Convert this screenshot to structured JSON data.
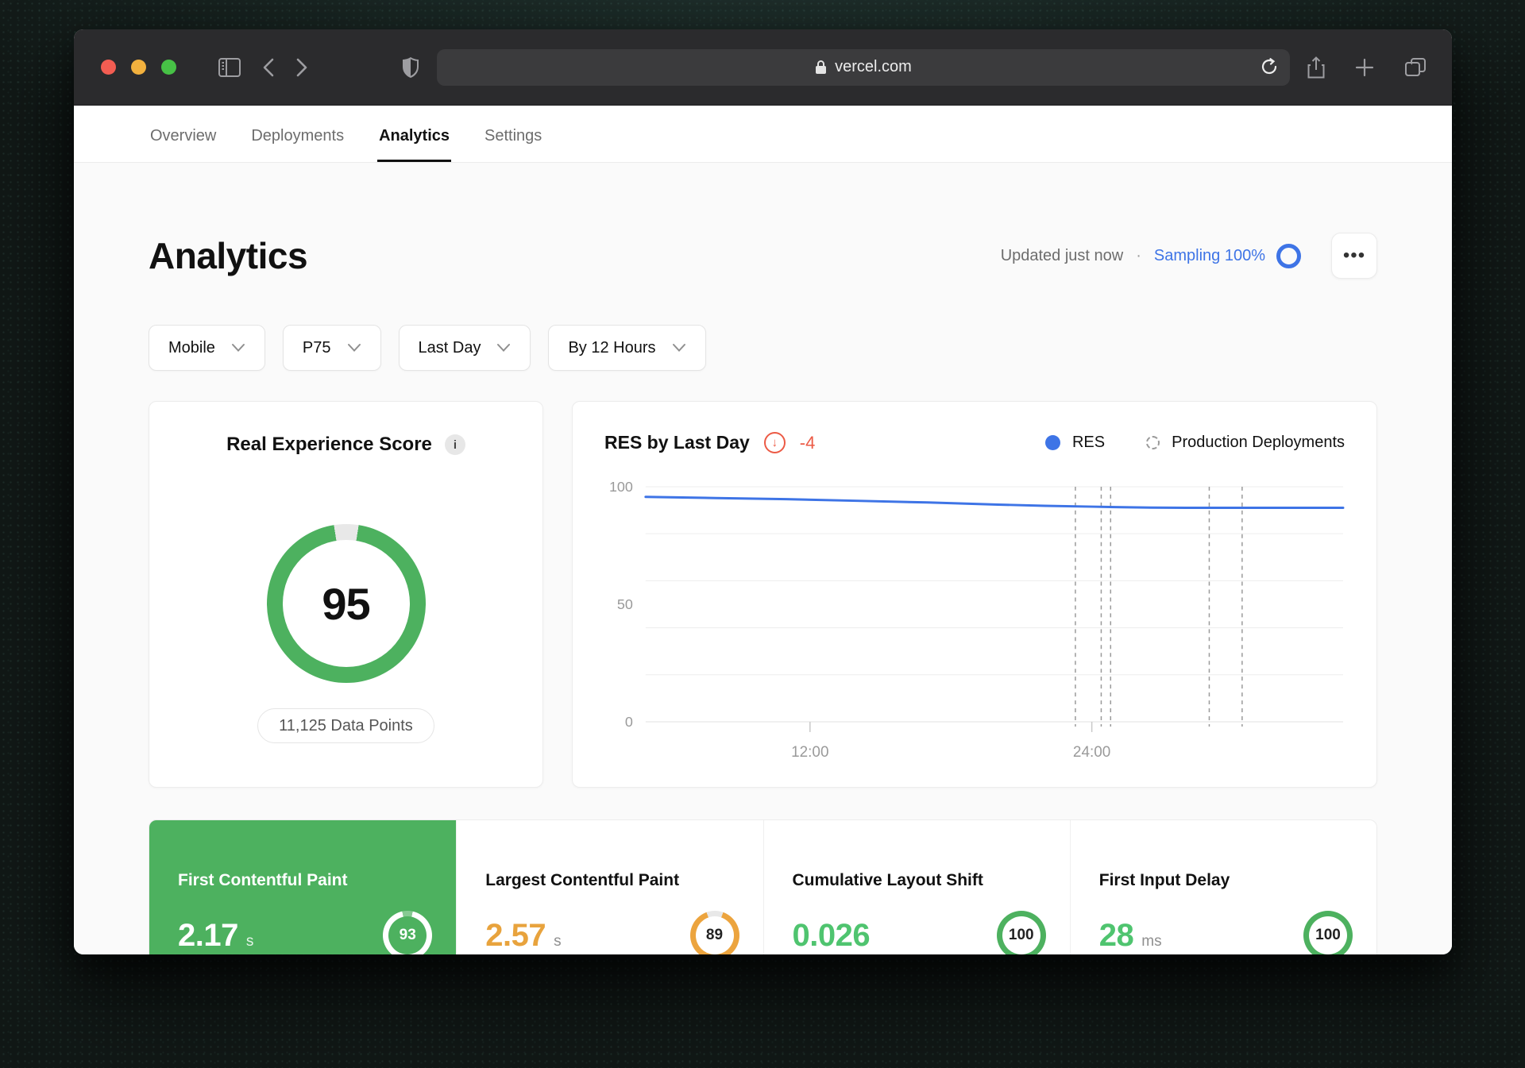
{
  "browser": {
    "url": "vercel.com",
    "window_controls": [
      "close",
      "minimize",
      "zoom"
    ]
  },
  "site_nav": {
    "tabs": [
      {
        "label": "Overview",
        "active": false
      },
      {
        "label": "Deployments",
        "active": false
      },
      {
        "label": "Analytics",
        "active": true
      },
      {
        "label": "Settings",
        "active": false
      }
    ]
  },
  "header": {
    "title": "Analytics",
    "updated": "Updated just now",
    "separator": "·",
    "sampling_label": "Sampling 100%",
    "more_label": "•••"
  },
  "filters": [
    {
      "label": "Mobile"
    },
    {
      "label": "P75"
    },
    {
      "label": "Last Day"
    },
    {
      "label": "By 12 Hours"
    }
  ],
  "res_card": {
    "title": "Real Experience Score",
    "score": "95",
    "score_value": 95,
    "pill": "11,125 Data Points"
  },
  "chart_card": {
    "title": "RES by Last Day",
    "delta_icon": "↓",
    "delta": "-4",
    "legend": [
      {
        "label": "RES"
      },
      {
        "label": "Production Deployments"
      }
    ]
  },
  "chart_data": {
    "type": "line",
    "title": "RES by Last Day",
    "x_unit": "hours",
    "x_domain": [
      5,
      34.7
    ],
    "x_ticks": [
      {
        "value": 12,
        "label": "12:00"
      },
      {
        "value": 24,
        "label": "24:00"
      }
    ],
    "y_domain": [
      0,
      100
    ],
    "y_gridlines": [
      0,
      20,
      40,
      60,
      80,
      100
    ],
    "y_tick_labels": [
      {
        "value": 100,
        "label": "100"
      },
      {
        "value": 50,
        "label": "50"
      },
      {
        "value": 0,
        "label": "0"
      }
    ],
    "grid": "horizontal",
    "legend_position": "top-right",
    "series": [
      {
        "name": "RES",
        "color_key": "blue",
        "points": [
          [
            5,
            95.7
          ],
          [
            8,
            95.2
          ],
          [
            11,
            94.7
          ],
          [
            14,
            94.0
          ],
          [
            17,
            93.3
          ],
          [
            20,
            92.4
          ],
          [
            22,
            91.9
          ],
          [
            24,
            91.5
          ],
          [
            25,
            91.3
          ],
          [
            26.5,
            91.1
          ],
          [
            28,
            91.0
          ],
          [
            31,
            91.0
          ],
          [
            34.7,
            91.0
          ]
        ]
      }
    ],
    "deployment_markers_x": [
      23.3,
      24.4,
      24.8,
      29.0,
      30.4
    ]
  },
  "metrics": [
    {
      "title": "First Contentful Paint",
      "value": "2.17",
      "unit": "s",
      "score": "93",
      "score_value": 93,
      "selected": true
    },
    {
      "title": "Largest Contentful Paint",
      "value": "2.57",
      "unit": "s",
      "score": "89",
      "score_value": 89,
      "selected": false
    },
    {
      "title": "Cumulative Layout Shift",
      "value": "0.026",
      "unit": "",
      "score": "100",
      "score_value": 100,
      "selected": false
    },
    {
      "title": "First Input Delay",
      "value": "28",
      "unit": "ms",
      "score": "100",
      "score_value": 100,
      "selected": false
    }
  ],
  "colors": {
    "blue": "#3e74e6",
    "green": "#4db15f",
    "green_value": "#4fc46f",
    "orange": "#e8a33d",
    "red": "#ec5a45",
    "axis_gray": "#9a9a9a",
    "traffic_red": "#f35d52",
    "traffic_yellow": "#f2b13e",
    "traffic_green": "#47c146"
  }
}
